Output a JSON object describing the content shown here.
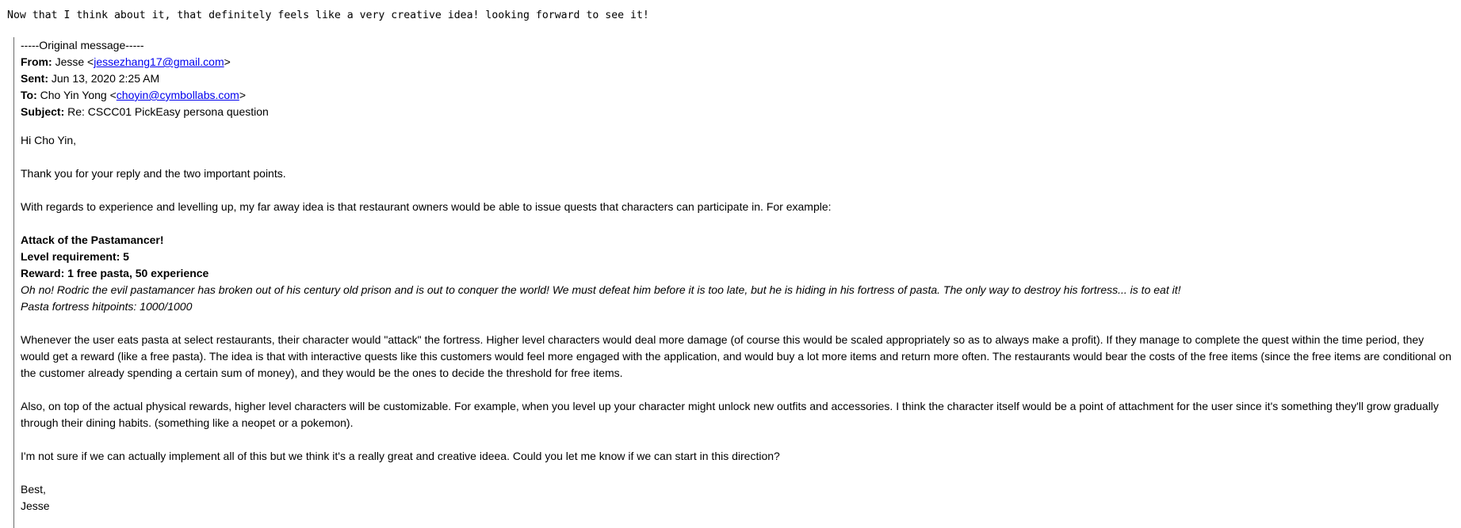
{
  "reply_line": "Now that I think about it, that definitely feels like a very creative idea! looking forward to see it!",
  "original": {
    "separator": "-----Original message-----",
    "from_label": "From:",
    "from_name": "Jesse <",
    "from_email": "jessezhang17@gmail.com",
    "from_close": ">",
    "sent_label": "Sent:",
    "sent_value": "Jun 13, 2020 2:25 AM",
    "to_label": "To:",
    "to_name": "Cho Yin Yong <",
    "to_email": "choyin@cymbollabs.com",
    "to_close": ">",
    "subject_label": "Subject:",
    "subject_value": "Re: CSCC01 PickEasy persona question"
  },
  "body": {
    "greeting": "Hi Cho Yin,",
    "thanks": "Thank you for your reply and the two important points.",
    "intro": "With regards to experience and levelling up, my far away idea is that restaurant owners would be able to issue quests that characters can participate in. For example:",
    "quest_title": "Attack of the Pastamancer!",
    "quest_level": "Level requirement: 5",
    "quest_reward": "Reward: 1 free pasta, 50 experience",
    "quest_story": "Oh no! Rodric the evil pastamancer has broken out of his century old prison  and is out to conquer the world! We must defeat him before it is too late, but he is hiding in his fortress of pasta. The only way to destroy his fortress... is to eat it!",
    "quest_hp": "Pasta fortress hitpoints: 1000/1000",
    "para1": "Whenever the user eats pasta at select restaurants, their character would \"attack\" the fortress. Higher level characters would deal more damage (of course this would be scaled appropriately so as to always make a profit). If they manage to complete the quest within the time period, they would get a reward (like a free pasta). The idea is that with interactive quests like this customers would feel more engaged with the application, and would buy a lot more items and return more often. The restaurants would bear the costs of the free items (since the free items are conditional on the customer already spending a certain sum of money), and they would be the ones to decide the threshold for free items.",
    "para2": "Also, on top of the actual physical rewards, higher level characters will be customizable. For example, when you level up your character might unlock new outfits and accessories. I think the character itself would be a point of attachment for the user since it's something they'll grow gradually through their dining habits. (something like a neopet or a pokemon).",
    "para3": "I'm not sure if we can actually implement all of this but we think it's a really great and creative ideea. Could you let me know if we can start in this direction?",
    "signoff": "Best,",
    "signature": "Jesse"
  }
}
